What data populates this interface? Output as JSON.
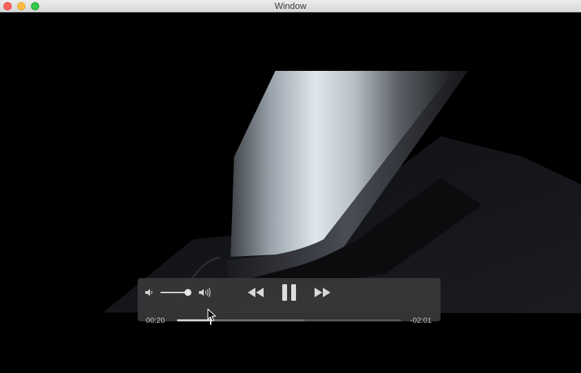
{
  "window": {
    "title": "Window"
  },
  "player": {
    "elapsed": "00:20",
    "remaining": "-02:01",
    "progress": 0.15,
    "buffered": 0.57,
    "volume": 0.9
  },
  "icons": {
    "close": "close-icon",
    "minimize": "minimize-icon",
    "zoom": "zoom-icon",
    "volume_min": "speaker-low-icon",
    "volume_max": "speaker-high-icon",
    "rewind": "rewind-icon",
    "pause": "pause-icon",
    "fast_forward": "fast-forward-icon",
    "cursor": "mouse-pointer-icon"
  },
  "colors": {
    "close": "#fc605c",
    "minimize": "#fdbc40",
    "zoom": "#34c749",
    "hud_background": "#3a3a3c"
  }
}
